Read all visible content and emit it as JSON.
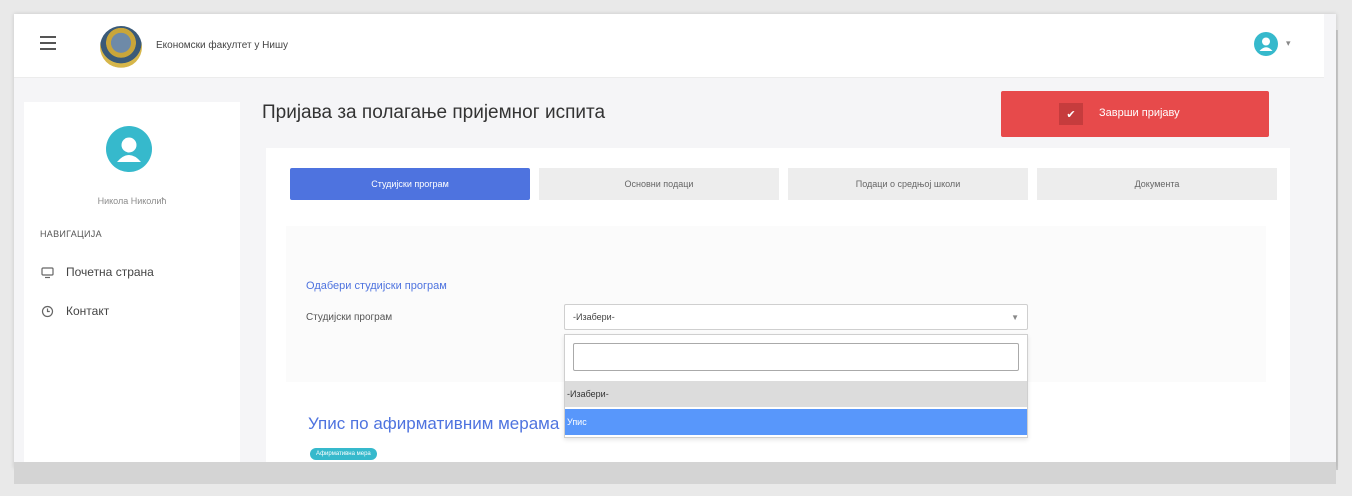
{
  "header": {
    "brand": "Економски факултет у Нишу",
    "caret": "▾"
  },
  "sidebar": {
    "user_name": "Никола Николић",
    "nav_heading": "НАВИГАЦИЈА",
    "items": [
      {
        "label": "Почетна страна",
        "icon": "monitor-icon"
      },
      {
        "label": "Контакт",
        "icon": "clock-icon"
      }
    ]
  },
  "main": {
    "title": "Пријава за полагање пријемног испита",
    "finish_button": "Заврши пријаву",
    "tabs": [
      {
        "label": "Студијски програм",
        "active": true
      },
      {
        "label": "Основни подаци",
        "active": false
      },
      {
        "label": "Подаци о средњој школи",
        "active": false
      },
      {
        "label": "Документа",
        "active": false
      }
    ],
    "section_title": "Одабери студијски програм",
    "field_label": "Студијски програм",
    "select_value": "-Изабери-",
    "dropdown": {
      "search_value": "",
      "options": [
        "-Изабери-",
        "Упис"
      ]
    },
    "section2_title": "Упис по афирмативним мерама",
    "badge": "Афирмативна мера"
  },
  "colors": {
    "primary": "#4e73df",
    "danger": "#e74a4b",
    "info": "#36b9cc",
    "highlight": "#5897fb"
  }
}
